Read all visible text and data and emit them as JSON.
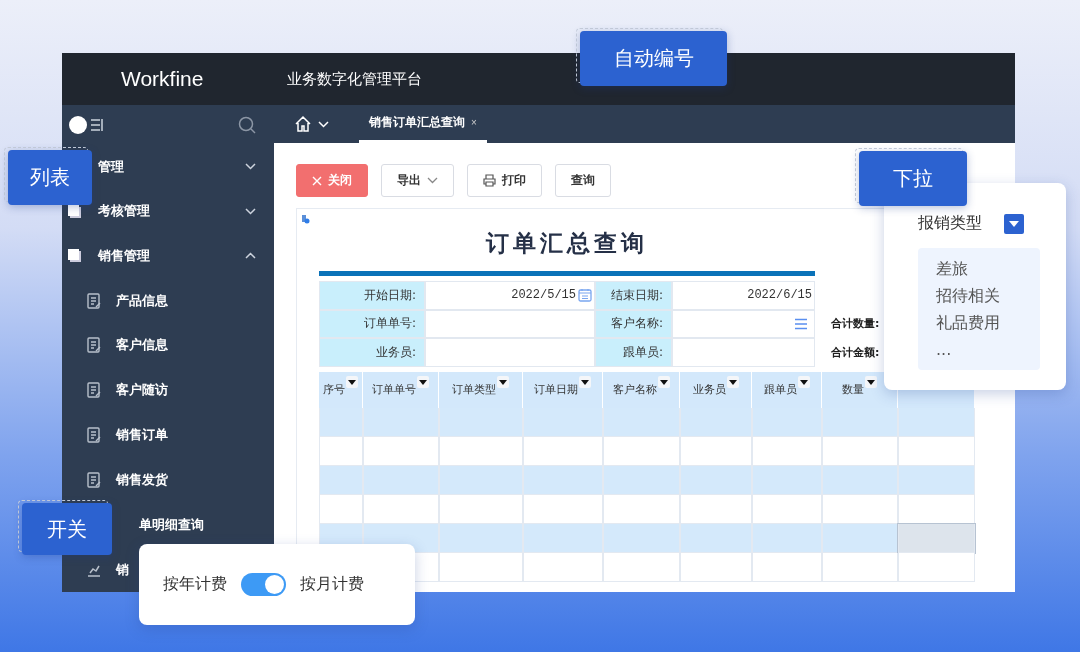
{
  "header": {
    "logo": "Workfine",
    "subtitle": "业务数字化管理平台"
  },
  "sidebar": {
    "groups": [
      {
        "label": "管理",
        "expanded": false
      },
      {
        "label": "考核管理",
        "expanded": false
      },
      {
        "label": "销售管理",
        "expanded": true,
        "children": [
          {
            "label": "产品信息",
            "kind": "doc"
          },
          {
            "label": "客户信息",
            "kind": "doc"
          },
          {
            "label": "客户随访",
            "kind": "doc"
          },
          {
            "label": "销售订单",
            "kind": "doc"
          },
          {
            "label": "销售发货",
            "kind": "doc"
          },
          {
            "label": "单明细查询",
            "kind": "hidden"
          },
          {
            "label": "销",
            "kind": "chart"
          }
        ]
      }
    ]
  },
  "tabs": [
    {
      "label": "销售订单汇总查询",
      "close": "×",
      "selected": true
    }
  ],
  "toolbar": [
    {
      "label": "关闭",
      "kind": "danger"
    },
    {
      "label": "导出",
      "kind": "dropdown"
    },
    {
      "label": "打印",
      "kind": "print"
    },
    {
      "label": "查询",
      "kind": "plain"
    }
  ],
  "report": {
    "title": "订单汇总查询",
    "form": [
      [
        {
          "label": "开始日期:",
          "value": "2022/5/15",
          "kind": "date"
        },
        {
          "label": "结束日期:",
          "value": "2022/6/15",
          "kind": "text"
        }
      ],
      [
        {
          "label": "订单单号:",
          "kind": "text"
        },
        {
          "label": "客户名称:",
          "kind": "list"
        }
      ],
      [
        {
          "label": "业务员:",
          "kind": "text"
        },
        {
          "label": "跟单员:",
          "kind": "text"
        }
      ]
    ],
    "totals": [
      "合计数量:",
      "合计金额:"
    ],
    "columns": [
      "序号",
      "订单单号",
      "订单类型",
      "订单日期",
      "客户名称",
      "业务员",
      "跟单员",
      "数量"
    ],
    "rows": [
      {
        "striped": true,
        "selected": false
      },
      {
        "striped": false,
        "selected": false
      },
      {
        "striped": true,
        "selected": false
      },
      {
        "striped": false,
        "selected": false
      },
      {
        "striped": true,
        "selected": true
      },
      {
        "striped": false,
        "selected": false
      }
    ]
  },
  "callouts": [
    {
      "label": "自动编号",
      "kind": "top"
    },
    {
      "label": "列表",
      "kind": "left"
    },
    {
      "label": "下拉",
      "kind": "right"
    },
    {
      "label": "开关",
      "kind": "bottom"
    }
  ],
  "dropdown_demo": {
    "label": "报销类型",
    "options": [
      "差旅",
      "招待相关",
      "礼品费用",
      "..."
    ]
  },
  "switch_demo": {
    "left": "按年计费",
    "right": "按月计费",
    "on": true
  }
}
